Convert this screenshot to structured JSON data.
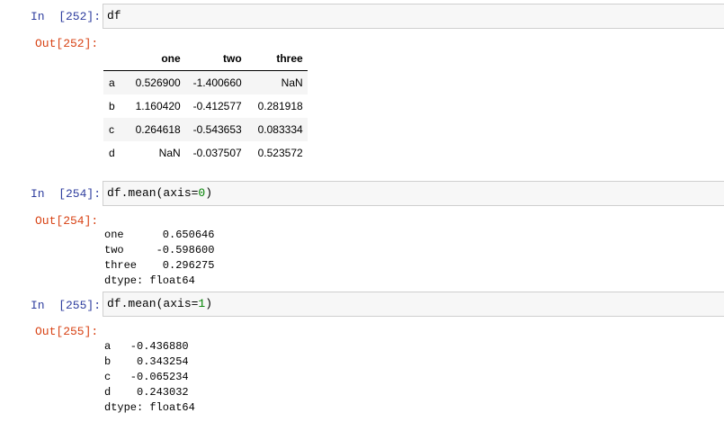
{
  "cells": [
    {
      "in_prompt": "In  [252]:",
      "code": "df",
      "out_prompt": "Out[252]:",
      "table": {
        "columns": [
          "",
          "one",
          "two",
          "three"
        ],
        "rows": [
          {
            "index": "a",
            "values": [
              "0.526900",
              "-1.400660",
              "NaN"
            ]
          },
          {
            "index": "b",
            "values": [
              "1.160420",
              "-0.412577",
              "0.281918"
            ]
          },
          {
            "index": "c",
            "values": [
              "0.264618",
              "-0.543653",
              "0.083334"
            ]
          },
          {
            "index": "d",
            "values": [
              "NaN",
              "-0.037507",
              "0.523572"
            ]
          }
        ]
      }
    },
    {
      "in_prompt": "In  [254]:",
      "code_prefix": "df.mean(axis=",
      "code_arg": "0",
      "code_suffix": ")",
      "out_prompt": "Out[254]:",
      "output_lines": [
        "one      0.650646",
        "two     -0.598600",
        "three    0.296275",
        "dtype: float64"
      ]
    },
    {
      "in_prompt": "In  [255]:",
      "code_prefix": "df.mean(axis=",
      "code_arg": "1",
      "code_suffix": ")",
      "out_prompt": "Out[255]:",
      "output_lines": [
        "a   -0.436880",
        "b    0.343254",
        "c   -0.065234",
        "d    0.243032",
        "dtype: float64"
      ]
    }
  ]
}
